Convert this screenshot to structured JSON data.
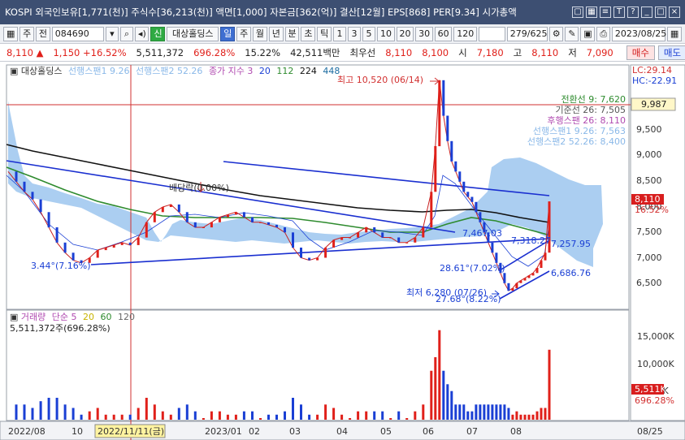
{
  "title_bar": {
    "text": "KOSPI 외국인보유[1,771(천)] 주식수[36,213(천)] 액면[1,000] 자본금[362(억)] 결산[12월] EPS[868] PER[9.34] 시가총액",
    "icons": [
      "save-icon",
      "grid-icon",
      "list-icon",
      "font-icon",
      "help-icon",
      "minimize-icon",
      "maximize-icon",
      "close-icon"
    ]
  },
  "toolbar": {
    "market_label": "주",
    "market_type": "전",
    "code": "084690",
    "stock_name": "대상홀딩스",
    "badge_new": "신",
    "periods": [
      "일",
      "주",
      "월",
      "년",
      "분",
      "초",
      "틱"
    ],
    "active_period": "일",
    "minute_options": [
      "1",
      "3",
      "5",
      "10",
      "20",
      "30",
      "60",
      "120"
    ],
    "count": "279/625",
    "date": "2023/08/25"
  },
  "quote": {
    "price": "8,110",
    "arrow": "▲",
    "change": "1,150",
    "change_pct": "+16.52%",
    "volume": "5,511,372",
    "volume_pct": "696.28%",
    "turnover": "15.22%",
    "amount": "42,511백만",
    "pref_label": "최우선",
    "pref_ask": "8,110",
    "pref_bid": "8,100",
    "open_label": "시",
    "open": "7,180",
    "high_label": "고",
    "high": "8,110",
    "low_label": "저",
    "low": "7,090",
    "buy": "매수",
    "sell": "매도"
  },
  "legend": {
    "name": "대상홀딩스",
    "span1": "선행스팬1 9.26",
    "span2": "선행스팬2 52.26",
    "close": "종가 지수 3",
    "ma20": "20",
    "ma112": "112",
    "ma224": "224",
    "ma448": "448",
    "lc": "LC:29.14",
    "hc": "HC:-22.91"
  },
  "ichimoku_labels": {
    "conv": "전환선 9: 7,620",
    "base": "기준선 26: 7,505",
    "lag": "후행스팬 26: 8,110",
    "span1": "선행스팬1 9.26: 7,563",
    "span2": "선행스팬2 52.26: 8,400"
  },
  "annotations": {
    "high": "최고 10,520 (06/14)",
    "low": "최저 6,280 (07/26)",
    "div": "배당락(0.00%)",
    "a1": "3.44°(7.16%)",
    "a2": "28.61°(7.02%)",
    "a3": "27.68°(8.22%)",
    "p1": "7,467.03",
    "p2": "7,318.27",
    "p3": "7,257.95",
    "p4": "6,686.76",
    "hline": "9,987",
    "last_price": "8,110",
    "last_pct": "16.52%"
  },
  "volume_legend": {
    "title": "거래량",
    "simple": "단순 5",
    "m20": "20",
    "m60": "60",
    "m120": "120",
    "value": "5,511,372주(696.28%)",
    "last": "5,511K",
    "last_pct": "696.28%"
  },
  "colors": {
    "up": "#e0201a",
    "down": "#1a3fd4",
    "cloud": "#9cc6ef",
    "ma_black": "#111111",
    "ma_green": "#2e8b2e",
    "trend": "#1a2fd0"
  },
  "chart_data": {
    "type": "line",
    "price_axis": [
      "9,500",
      "9,000",
      "8,500",
      "8,000",
      "7,500",
      "7,000",
      "6,500"
    ],
    "volume_axis": [
      "15,000K",
      "10,000K",
      "5,000K"
    ],
    "x_labels": [
      "2022/08",
      "10",
      "2022/11/11(금)",
      "2023/01",
      "02",
      "03",
      "04",
      "05",
      "06",
      "07",
      "08",
      "08/25"
    ],
    "ylim": [
      6000,
      10800
    ],
    "close_path": [
      [
        0,
        8700
      ],
      [
        4,
        8500
      ],
      [
        8,
        8300
      ],
      [
        12,
        8150
      ],
      [
        16,
        7900
      ],
      [
        20,
        7600
      ],
      [
        24,
        7300
      ],
      [
        28,
        7100
      ],
      [
        32,
        6950
      ],
      [
        36,
        6900
      ],
      [
        40,
        7000
      ],
      [
        44,
        7150
      ],
      [
        48,
        7200
      ],
      [
        52,
        7250
      ],
      [
        56,
        7300
      ],
      [
        60,
        7250
      ],
      [
        64,
        7400
      ],
      [
        68,
        7700
      ],
      [
        72,
        7900
      ],
      [
        76,
        8000
      ],
      [
        80,
        8050
      ],
      [
        84,
        7900
      ],
      [
        88,
        7700
      ],
      [
        92,
        7600
      ],
      [
        96,
        7600
      ],
      [
        100,
        7700
      ],
      [
        104,
        7800
      ],
      [
        108,
        7850
      ],
      [
        112,
        7900
      ],
      [
        116,
        7800
      ],
      [
        120,
        7700
      ],
      [
        124,
        7700
      ],
      [
        128,
        7650
      ],
      [
        132,
        7600
      ],
      [
        136,
        7500
      ],
      [
        140,
        7200
      ],
      [
        144,
        7000
      ],
      [
        148,
        6950
      ],
      [
        152,
        7000
      ],
      [
        156,
        7200
      ],
      [
        160,
        7350
      ],
      [
        164,
        7400
      ],
      [
        168,
        7400
      ],
      [
        172,
        7500
      ],
      [
        176,
        7600
      ],
      [
        180,
        7500
      ],
      [
        184,
        7400
      ],
      [
        188,
        7400
      ],
      [
        192,
        7300
      ],
      [
        196,
        7300
      ],
      [
        200,
        7400
      ],
      [
        204,
        7600
      ],
      [
        208,
        8300
      ],
      [
        210,
        9200
      ],
      [
        212,
        10500
      ],
      [
        214,
        9800
      ],
      [
        216,
        9300
      ],
      [
        218,
        8900
      ],
      [
        220,
        8700
      ],
      [
        222,
        8500
      ],
      [
        224,
        8300
      ],
      [
        226,
        8200
      ],
      [
        228,
        8100
      ],
      [
        230,
        7900
      ],
      [
        232,
        7700
      ],
      [
        234,
        7500
      ],
      [
        236,
        7300
      ],
      [
        238,
        7100
      ],
      [
        240,
        6900
      ],
      [
        242,
        6700
      ],
      [
        244,
        6500
      ],
      [
        246,
        6350
      ],
      [
        248,
        6400
      ],
      [
        250,
        6500
      ],
      [
        252,
        6550
      ],
      [
        254,
        6600
      ],
      [
        256,
        6650
      ],
      [
        258,
        6700
      ],
      [
        260,
        6800
      ],
      [
        262,
        6950
      ],
      [
        264,
        7100
      ],
      [
        266,
        8110
      ]
    ]
  }
}
